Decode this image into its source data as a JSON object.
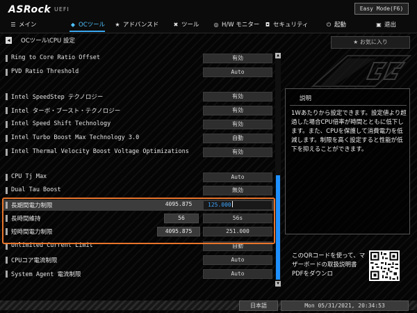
{
  "header": {
    "logo": "ASRock",
    "uefi": "UEFI",
    "easy_mode": "Easy Mode(F6)",
    "tabs": [
      {
        "icon": "☰",
        "label": "メイン"
      },
      {
        "icon": "◆",
        "label": "OCツール"
      },
      {
        "icon": "★",
        "label": "アドバンスド"
      },
      {
        "icon": "✖",
        "label": "ツール"
      },
      {
        "icon": "◎",
        "label": "H/W モニター"
      },
      {
        "icon": "◘",
        "label": "セキュリティ"
      },
      {
        "icon": "⏻",
        "label": "起動"
      },
      {
        "icon": "▣",
        "label": "退出"
      }
    ]
  },
  "breadcrumb": "OCツール\\CPU 設定",
  "favorite": "★  お気に入り",
  "settings": [
    {
      "label": "Ring to Core Ratio Offset",
      "value": "有効"
    },
    {
      "label": "PVD Ratio Threshold",
      "value": "Auto"
    },
    {
      "label": "Intel SpeedStep テクノロジー",
      "value": "有効"
    },
    {
      "label": "Intel ターボ・ブースト・テクノロジー",
      "value": "有効"
    },
    {
      "label": "Intel Speed Shift Technology",
      "value": "有効"
    },
    {
      "label": "Intel Turbo Boost Max Technology 3.0",
      "value": "自動"
    },
    {
      "label": "Intel Thermal Velocity Boost Voltage Optimizations",
      "value": "有効"
    },
    {
      "label": "CPU Tj Max",
      "value": "Auto"
    },
    {
      "label": "Dual Tau Boost",
      "value": "無効"
    },
    {
      "label": "長期間電力制限",
      "current": "4095.875",
      "value": "125.000"
    },
    {
      "label": "長時間維持",
      "current": "56",
      "value": "56s"
    },
    {
      "label": "短時間電力制限",
      "current": "4095.875",
      "value": "251.000"
    },
    {
      "label": "Unlimited Current Limit",
      "value": "自動"
    },
    {
      "label": "CPUコア電流制限",
      "value": "Auto"
    },
    {
      "label": "System Agent 電流制限",
      "value": "Auto"
    }
  ],
  "description": {
    "title": "説明",
    "body": "1Wあたりから設定できます。設定値より超過した場合CPU倍率が時間とともに低下します。また、CPUを保護して消費電力を低減します。制限を高く設定すると性能が低下を抑えることができます。"
  },
  "qr_text": "このQRコードを使って、マザーボードの取扱説明書PDFをダウンロ",
  "footer": {
    "language": "日本語",
    "datetime": "Mon 05/31/2021, 20:34:53"
  },
  "colors": {
    "accent": "#3aa8f0",
    "highlight_border": "#e9752b",
    "scroll_thumb": "#1e90ff"
  }
}
